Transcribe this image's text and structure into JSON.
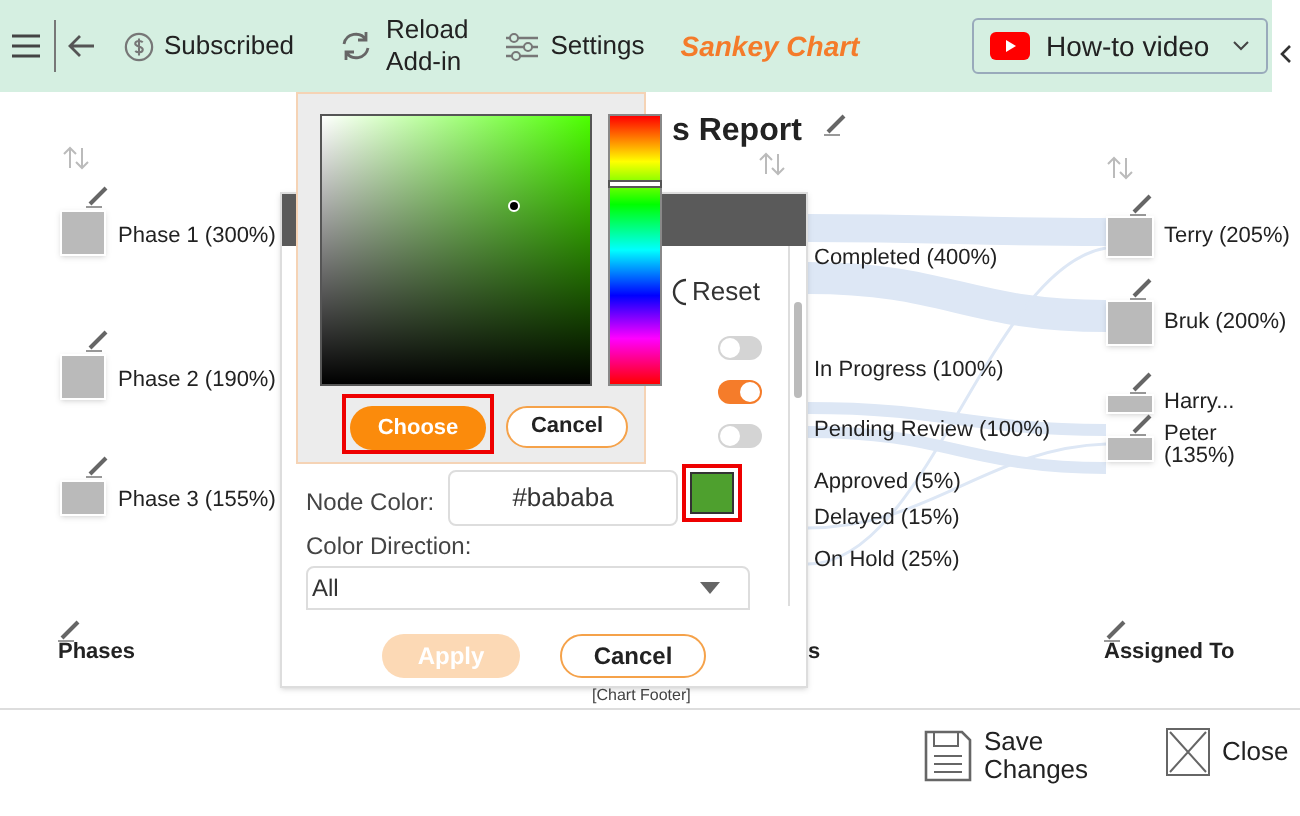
{
  "toolbar": {
    "subscribed": "Subscribed",
    "reload": [
      "Reload",
      "Add-in"
    ],
    "settings": "Settings",
    "app_title": "Sankey Chart",
    "howto": "How-to video"
  },
  "chart": {
    "title": "s Report",
    "footer": "[Chart Footer]",
    "columns": [
      {
        "label": "Phases"
      },
      {
        "label": "s"
      },
      {
        "label": "Assigned To"
      }
    ],
    "left_nodes": [
      {
        "label": "Phase 1 (300%)"
      },
      {
        "label": "Phase 2 (190%)"
      },
      {
        "label": "Phase 3 (155%)"
      }
    ],
    "middle_nodes": [
      {
        "label": "Completed (400%)"
      },
      {
        "label": "In Progress (100%)"
      },
      {
        "label": "Pending Review (100%)"
      },
      {
        "label": "Approved (5%)"
      },
      {
        "label": "Delayed (15%)"
      },
      {
        "label": "On Hold (25%)"
      }
    ],
    "right_nodes": [
      {
        "label": "Terry (205%)"
      },
      {
        "label": "Bruk (200%)"
      },
      {
        "label": "Harry..."
      },
      {
        "label": "Peter\n(135%)"
      }
    ]
  },
  "panel": {
    "reset": "Reset",
    "toggles": [
      {
        "on": false
      },
      {
        "on": true
      },
      {
        "on": false
      }
    ],
    "node_color_label": "Node Color:",
    "node_color_value": "#bababa",
    "swatch": {
      "color": "#4ea02e"
    },
    "color_direction_label": "Color Direction:",
    "color_direction_value": "All",
    "apply": {
      "label": "Apply",
      "disabled": true
    },
    "cancel": "Cancel"
  },
  "picker": {
    "choose": "Choose",
    "cancel": "Cancel"
  },
  "footer": {
    "save": [
      "Save",
      "Changes"
    ],
    "close": "Close"
  }
}
